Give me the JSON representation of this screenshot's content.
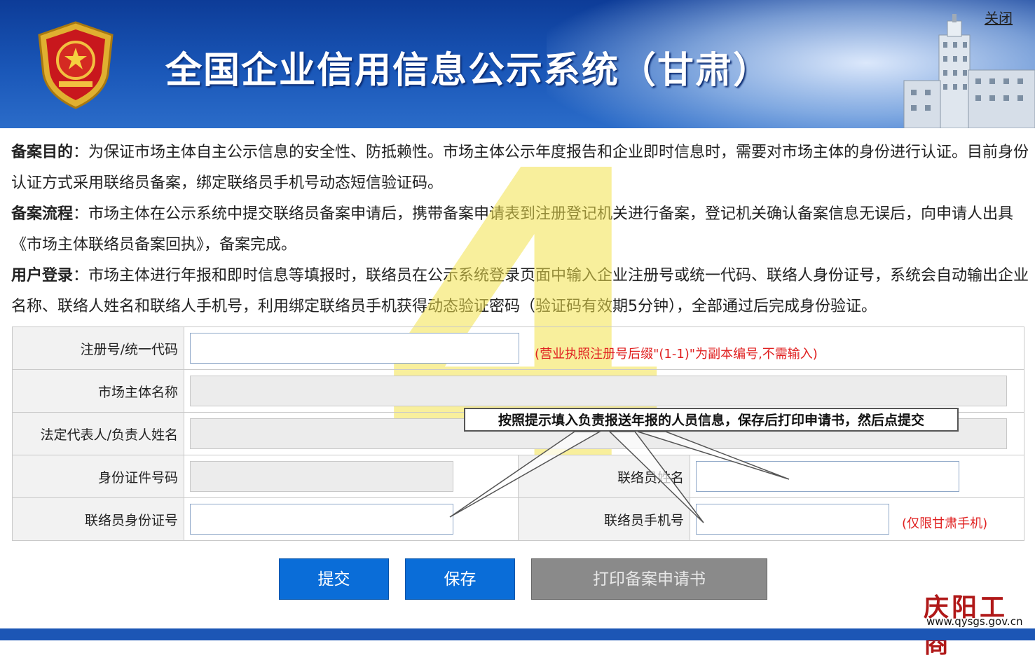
{
  "header": {
    "title": "全国企业信用信息公示系统（甘肃）",
    "close_label": "关闭",
    "bg_color": "#1a57b8"
  },
  "intro": [
    {
      "label": "备案目的",
      "sep": "：",
      "text": "为保证市场主体自主公示信息的安全性、防抵赖性。市场主体公示年度报告和企业即时信息时，需要对市场主体的身份进行认证。目前身份认证方式采用联络员备案，绑定联络员手机号动态短信验证码。"
    },
    {
      "label": "备案流程",
      "sep": "：",
      "text": "市场主体在公示系统中提交联络员备案申请后，携带备案申请表到注册登记机关进行备案，登记机关确认备案信息无误后，向申请人出具《市场主体联络员备案回执》，备案完成。"
    },
    {
      "label": "用户登录",
      "sep": "：",
      "text": "市场主体进行年报和即时信息等填报时，联络员在公示系统登录页面中输入企业注册号或统一代码、联络人身份证号，系统会自动输出企业名称、联络人姓名和联络人手机号，利用绑定联络员手机获得动态验证密码（验证码有效期5分钟），全部通过后完成身份验证。"
    }
  ],
  "form": {
    "reg_label": "注册号/统一代码",
    "reg_hint": "(营业执照注册号后缀\"(1-1)\"为副本编号,不需输入)",
    "name_label": "市场主体名称",
    "legal_label": "法定代表人/负责人姓名",
    "idcard_label": "身份证件号码",
    "contact_name_label": "联络员姓名",
    "contact_id_label": "联络员身份证号",
    "contact_phone_label": "联络员手机号",
    "phone_hint": "(仅限甘肃手机)"
  },
  "tooltip": "按照提示填入负责报送年报的人员信息，保存后打印申请书，然后点提交",
  "watermark": "4",
  "buttons": {
    "submit": "提交",
    "save": "保存",
    "print": "打印备案申请书"
  },
  "brand": {
    "name": "庆阳工商",
    "url": "www.qysgs.gov.cn"
  }
}
